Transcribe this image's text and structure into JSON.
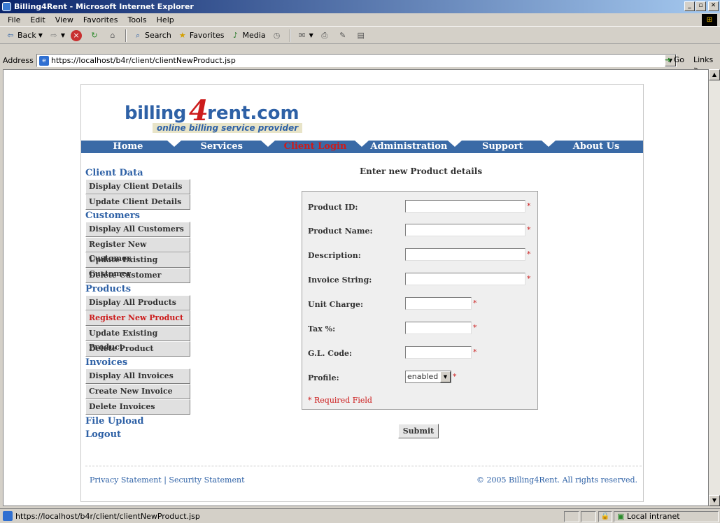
{
  "window": {
    "title": "Billing4Rent - Microsoft Internet Explorer"
  },
  "menubar": [
    "File",
    "Edit",
    "View",
    "Favorites",
    "Tools",
    "Help"
  ],
  "toolbar": {
    "back": "Back",
    "search": "Search",
    "favorites": "Favorites",
    "media": "Media"
  },
  "address": {
    "label": "Address",
    "url": "https://localhost/b4r/client/clientNewProduct.jsp",
    "go": "Go",
    "links": "Links"
  },
  "site": {
    "logo_left": "billing",
    "logo_four": "4",
    "logo_right": "rent.com",
    "tagline": "online billing service provider",
    "nav": [
      "Home",
      "Services",
      "Client Login",
      "Administration",
      "Support",
      "About Us"
    ],
    "active_nav": "Client Login"
  },
  "sidebar": {
    "client_data": "Client Data",
    "client_items": [
      "Display Client Details",
      "Update Client Details"
    ],
    "customers": "Customers",
    "customer_items": [
      "Display All Customers",
      "Register New Customer",
      "Update Existing Customer",
      "Delete Customer"
    ],
    "products": "Products",
    "product_items": [
      "Display All Products",
      "Register New Product",
      "Update Existing Product",
      "Delete Product"
    ],
    "invoices": "Invoices",
    "invoice_items": [
      "Display All Invoices",
      "Create New Invoice",
      "Delete Invoices"
    ],
    "file_upload": "File Upload",
    "logout": "Logout"
  },
  "form": {
    "title": "Enter new Product details",
    "fields": [
      {
        "label": "Product ID:",
        "value": "",
        "required": "*"
      },
      {
        "label": "Product Name:",
        "value": "",
        "required": "*"
      },
      {
        "label": "Description:",
        "value": "",
        "required": "*"
      },
      {
        "label": "Invoice String:",
        "value": "",
        "required": "*"
      },
      {
        "label": "Unit Charge:",
        "value": "",
        "required": "*"
      },
      {
        "label": "Tax %:",
        "value": "",
        "required": "*"
      },
      {
        "label": "G.L. Code:",
        "value": "",
        "required": "*"
      }
    ],
    "profile_label": "Profile:",
    "profile_value": "enabled",
    "profile_required": "*",
    "required_note": "* Required Field",
    "submit": "Submit"
  },
  "footer": {
    "left": "Privacy Statement | Security Statement",
    "right": "© 2005 Billing4Rent. All rights reserved."
  },
  "status": {
    "url": "https://localhost/b4r/client/clientNewProduct.jsp",
    "zone": "Local intranet"
  }
}
